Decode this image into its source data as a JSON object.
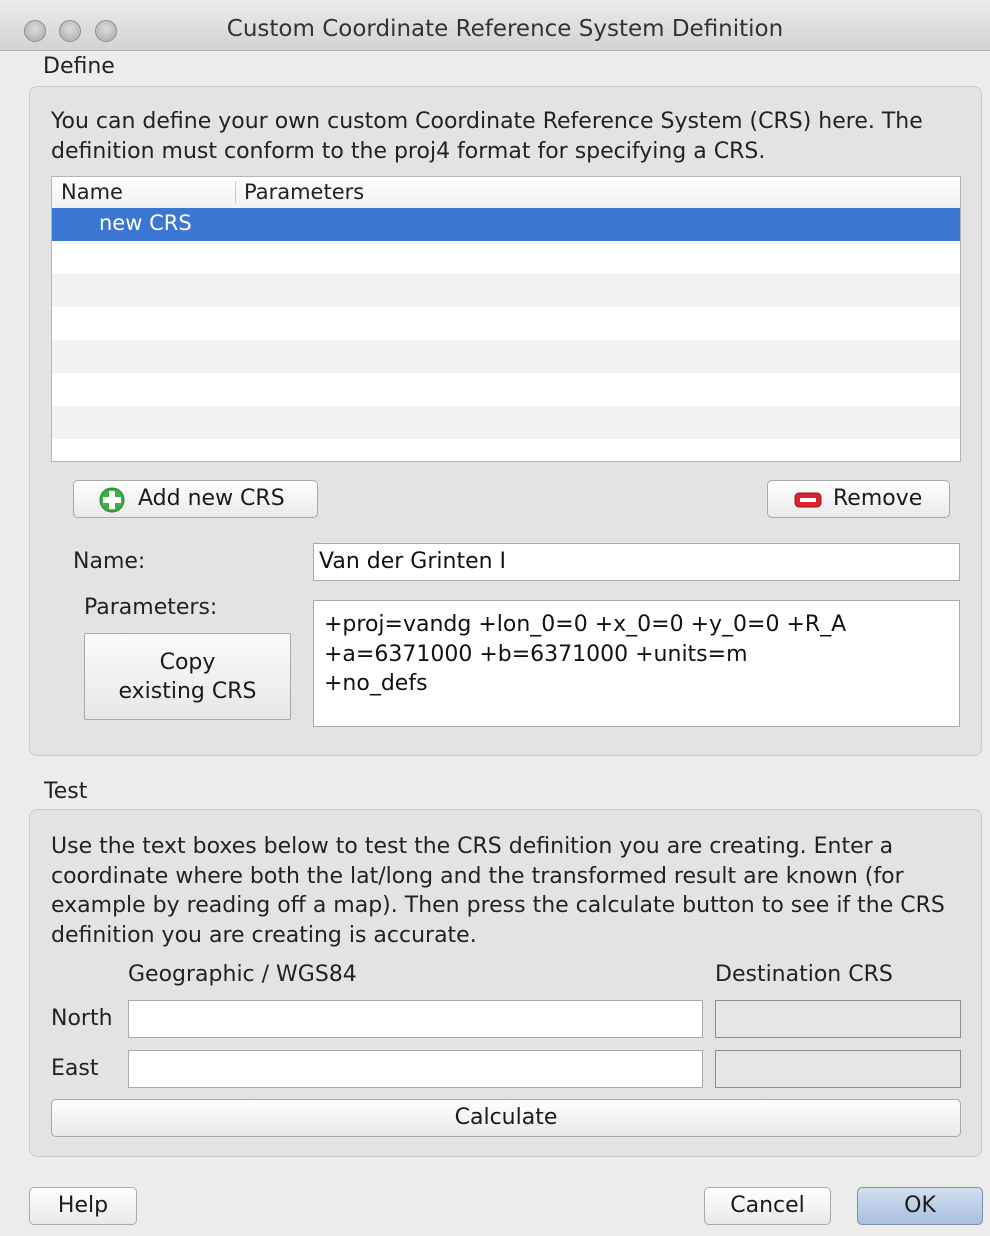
{
  "window": {
    "title": "Custom Coordinate Reference System Definition"
  },
  "define": {
    "label": "Define",
    "description": "You can define your own custom Coordinate Reference System (CRS) here. The definition must conform to the proj4 format for specifying a CRS.",
    "table": {
      "columns": [
        "Name",
        "Parameters"
      ],
      "rows": [
        {
          "name": "new CRS",
          "parameters": "",
          "selected": true
        }
      ]
    },
    "add_button_label": "Add new CRS",
    "remove_button_label": "Remove",
    "name_label": "Name:",
    "name_value": "Van der Grinten I",
    "parameters_label": "Parameters:",
    "copy_button_label": "Copy\nexisting CRS",
    "parameters_value": "+proj=vandg +lon_0=0 +x_0=0 +y_0=0 +R_A\n+a=6371000 +b=6371000 +units=m\n+no_defs"
  },
  "test": {
    "label": "Test",
    "description": "Use the text boxes below to test the CRS definition you are creating. Enter a coordinate where both the lat/long and the transformed result are known (for example by reading off a map). Then press the calculate button to see if the CRS definition you are creating is accurate.",
    "geographic_header": "Geographic / WGS84",
    "destination_header": "Destination CRS",
    "north_label": "North",
    "east_label": "East",
    "north_value": "",
    "east_value": "",
    "dest_north_value": "",
    "dest_east_value": "",
    "calculate_label": "Calculate"
  },
  "footer": {
    "help_label": "Help",
    "cancel_label": "Cancel",
    "ok_label": "OK"
  },
  "colors": {
    "selection": "#3a76d2",
    "add_icon": "#3cb043",
    "remove_icon": "#d9232e"
  },
  "icons": [
    "add-icon",
    "remove-icon"
  ]
}
